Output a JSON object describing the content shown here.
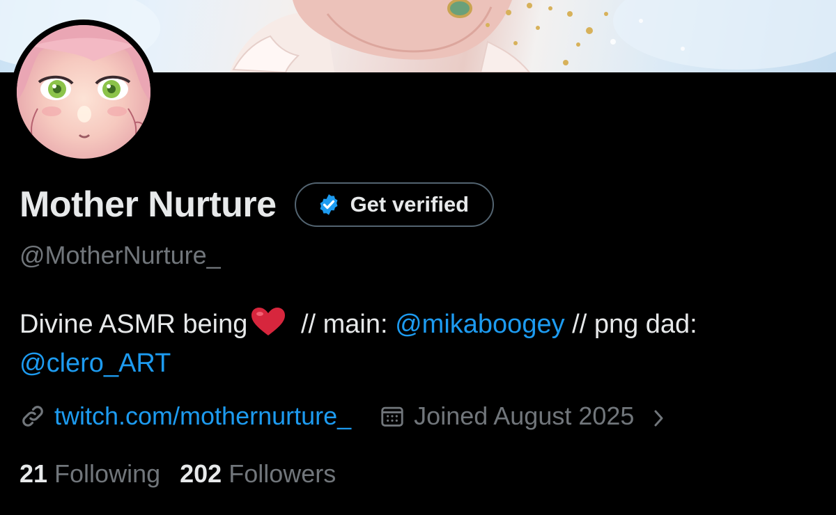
{
  "profile": {
    "display_name": "Mother Nurture",
    "handle": "@MotherNurture_",
    "get_verified_label": "Get verified",
    "bio": {
      "text_before": "Divine ASMR being",
      "heart_emoji": "❤️",
      "text_main": " // main: ",
      "mention_main": "@mikaboogey",
      "text_dad": " // png dad:",
      "mention_dad": "@clero_ART"
    },
    "link": "twitch.com/mothernurture_",
    "joined": "Joined August 2025",
    "following_count": "21",
    "following_label": "Following",
    "followers_count": "202",
    "followers_label": "Followers"
  },
  "icons": {
    "verified": "verified-badge-icon",
    "link": "link-icon",
    "calendar": "calendar-icon",
    "chevron": "chevron-right-icon"
  },
  "colors": {
    "background": "#000000",
    "primary_text": "#e7e9ea",
    "secondary_text": "#71767b",
    "accent": "#1d9bf0",
    "button_border": "#536471"
  }
}
